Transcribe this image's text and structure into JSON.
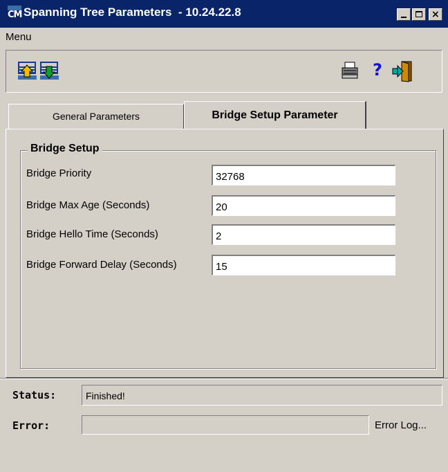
{
  "window": {
    "title": "Spanning Tree Parameters  - 10.24.22.8",
    "app_icon_text": "CM"
  },
  "menubar": {
    "menu_label": "Menu"
  },
  "toolbar": {
    "icons": [
      "upload-icon",
      "download-icon",
      "print-icon",
      "help-icon",
      "exit-icon"
    ],
    "help_glyph": "?"
  },
  "tabs": {
    "general": "General Parameters",
    "bridge": "Bridge Setup Parameter",
    "active": "bridge"
  },
  "bridge_setup": {
    "title": "Bridge Setup",
    "fields": [
      {
        "label": "Bridge Priority",
        "value": "32768"
      },
      {
        "label": "Bridge Max Age (Seconds)",
        "value": "20"
      },
      {
        "label": "Bridge Hello Time (Seconds)",
        "value": "2"
      },
      {
        "label": "Bridge Forward Delay (Seconds)",
        "value": "15"
      }
    ]
  },
  "footer": {
    "status_label": "Status:",
    "status_value": "Finished!",
    "error_label": "Error:",
    "error_value": "",
    "error_log_label": "Error Log..."
  },
  "colors": {
    "titlebar": "#0a246a",
    "face": "#d4d0c8"
  }
}
